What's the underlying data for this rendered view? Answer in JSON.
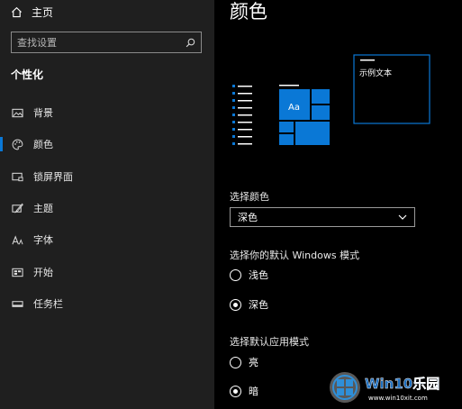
{
  "sidebar": {
    "home_label": "主页",
    "search_placeholder": "查找设置",
    "section_title": "个性化",
    "items": [
      {
        "label": "背景",
        "icon": "image-icon"
      },
      {
        "label": "颜色",
        "icon": "palette-icon",
        "active": true
      },
      {
        "label": "锁屏界面",
        "icon": "lock-screen-icon"
      },
      {
        "label": "主题",
        "icon": "theme-brush-icon"
      },
      {
        "label": "字体",
        "icon": "font-icon"
      },
      {
        "label": "开始",
        "icon": "start-icon"
      },
      {
        "label": "任务栏",
        "icon": "taskbar-icon"
      }
    ]
  },
  "main": {
    "title": "颜色",
    "preview": {
      "tile_text": "Aa",
      "sample_text": "示例文本"
    },
    "choose_color": {
      "label": "选择颜色",
      "selected": "深色"
    },
    "windows_mode": {
      "label": "选择你的默认 Windows 模式",
      "options": [
        {
          "label": "浅色",
          "checked": false
        },
        {
          "label": "深色",
          "checked": true
        }
      ]
    },
    "app_mode": {
      "label": "选择默认应用模式",
      "options": [
        {
          "label": "亮",
          "checked": false
        },
        {
          "label": "暗",
          "checked": true
        }
      ]
    }
  },
  "watermark": {
    "brand": "Win10乐园",
    "url": "www.win10xit.com"
  },
  "colors": {
    "accent": "#0a78d6",
    "sidebar_bg": "#1f1f1f",
    "main_bg": "#000000"
  }
}
